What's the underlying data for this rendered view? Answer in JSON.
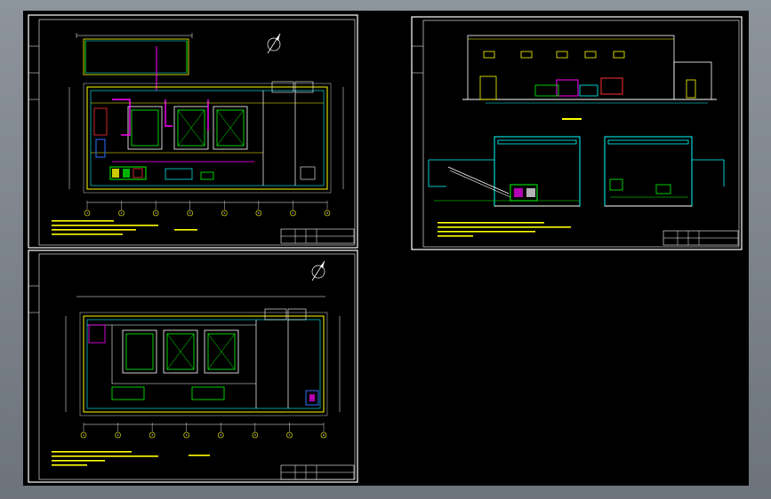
{
  "colors": {
    "background": "#000000",
    "sheet_border": "#ffffff",
    "wall": "#ffff00",
    "pipe": "#ff00ff",
    "equipment": "#00ff00",
    "structure": "#00ffff",
    "dimension": "#ffffff",
    "red": "#ff3030",
    "blue": "#3070ff"
  },
  "sheets": [
    {
      "name": "plan-upper",
      "axis_labels": [
        "1",
        "2",
        "3",
        "4",
        "5",
        "6",
        "7",
        "8"
      ]
    },
    {
      "name": "elevations-sections"
    },
    {
      "name": "plan-lower",
      "axis_labels": [
        "1",
        "2",
        "3",
        "4",
        "5",
        "6",
        "7",
        "8"
      ]
    }
  ],
  "icons": [
    "north-arrow-icon"
  ]
}
